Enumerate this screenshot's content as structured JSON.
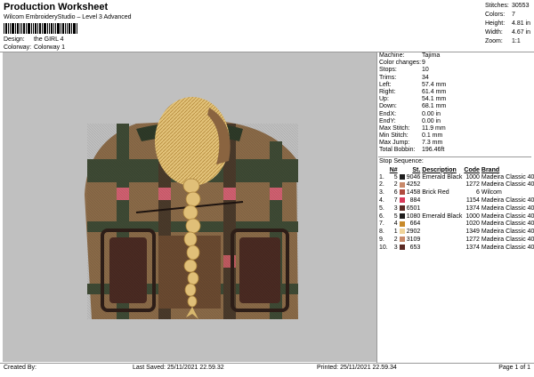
{
  "header": {
    "title": "Production Worksheet",
    "subtitle": "Wilcom EmbroideryStudio – Level 3 Advanced",
    "design_label": "Design:",
    "design_value": "the GIRL 4",
    "colorway_label": "Colorway:",
    "colorway_value": "Colorway 1"
  },
  "top_stats": [
    {
      "label": "Stitches:",
      "value": "30553"
    },
    {
      "label": "Colors:",
      "value": "7"
    },
    {
      "label": "Height:",
      "value": "4.81 in"
    },
    {
      "label": "Width:",
      "value": "4.67 in"
    },
    {
      "label": "Zoom:",
      "value": "1:1"
    }
  ],
  "details": [
    {
      "label": "Machine:",
      "value": "Tajima"
    },
    {
      "label": "Color changes:",
      "value": "9"
    },
    {
      "label": "Stops:",
      "value": "10"
    },
    {
      "label": "Trims:",
      "value": "34"
    },
    {
      "label": "Left:",
      "value": "57.4 mm"
    },
    {
      "label": "Right:",
      "value": "61.4 mm"
    },
    {
      "label": "Up:",
      "value": "54.1 mm"
    },
    {
      "label": "Down:",
      "value": "68.1 mm"
    },
    {
      "label": "EndX:",
      "value": "0.00 in"
    },
    {
      "label": "EndY:",
      "value": "0.00 in"
    },
    {
      "label": "Max Stitch:",
      "value": "11.9 mm"
    },
    {
      "label": "Min Stitch:",
      "value": "0.1 mm"
    },
    {
      "label": "Max Jump:",
      "value": "7.3 mm"
    },
    {
      "label": "Total Bobbin:",
      "value": "196.46ft"
    }
  ],
  "stop_sequence": {
    "title": "Stop Sequence:",
    "headers": {
      "n": "N#",
      "st": "St.",
      "desc": "Description",
      "code": "Code",
      "brand": "Brand"
    },
    "rows": [
      {
        "idx": "1.",
        "n": "5",
        "color": "#1e1e1e",
        "st": "9046",
        "desc": "Emerald Black",
        "code": "1000",
        "brand": "Madeira Classic 40"
      },
      {
        "idx": "2.",
        "n": "2",
        "color": "#c8896a",
        "st": "4252",
        "desc": "",
        "code": "1272",
        "brand": "Madeira Classic 40"
      },
      {
        "idx": "3.",
        "n": "6",
        "color": "#b04a3e",
        "st": "1458",
        "desc": "Brick Red",
        "code": "6",
        "brand": "Wilcom"
      },
      {
        "idx": "4.",
        "n": "7",
        "color": "#d9395a",
        "st": "884",
        "desc": "",
        "code": "1154",
        "brand": "Madeira Classic 40"
      },
      {
        "idx": "5.",
        "n": "3",
        "color": "#5a2a24",
        "st": "6501",
        "desc": "",
        "code": "1374",
        "brand": "Madeira Classic 40"
      },
      {
        "idx": "6.",
        "n": "5",
        "color": "#1e1e1e",
        "st": "1080",
        "desc": "Emerald Black",
        "code": "1000",
        "brand": "Madeira Classic 40"
      },
      {
        "idx": "7.",
        "n": "4",
        "color": "#c88a2a",
        "st": "664",
        "desc": "",
        "code": "1020",
        "brand": "Madeira Classic 40"
      },
      {
        "idx": "8.",
        "n": "1",
        "color": "#f0d49a",
        "st": "2902",
        "desc": "",
        "code": "1349",
        "brand": "Madeira Classic 40"
      },
      {
        "idx": "9.",
        "n": "2",
        "color": "#c8896a",
        "st": "3109",
        "desc": "",
        "code": "1272",
        "brand": "Madeira Classic 40"
      },
      {
        "idx": "10.",
        "n": "3",
        "color": "#5a2a24",
        "st": "653",
        "desc": "",
        "code": "1374",
        "brand": "Madeira Classic 40"
      }
    ]
  },
  "footer": {
    "created_by": "Created By:",
    "last_saved": "Last Saved: 25/11/2021 22.59.32",
    "printed": "Printed: 25/11/2021 22.59.34",
    "page": "Page 1 of 1"
  }
}
